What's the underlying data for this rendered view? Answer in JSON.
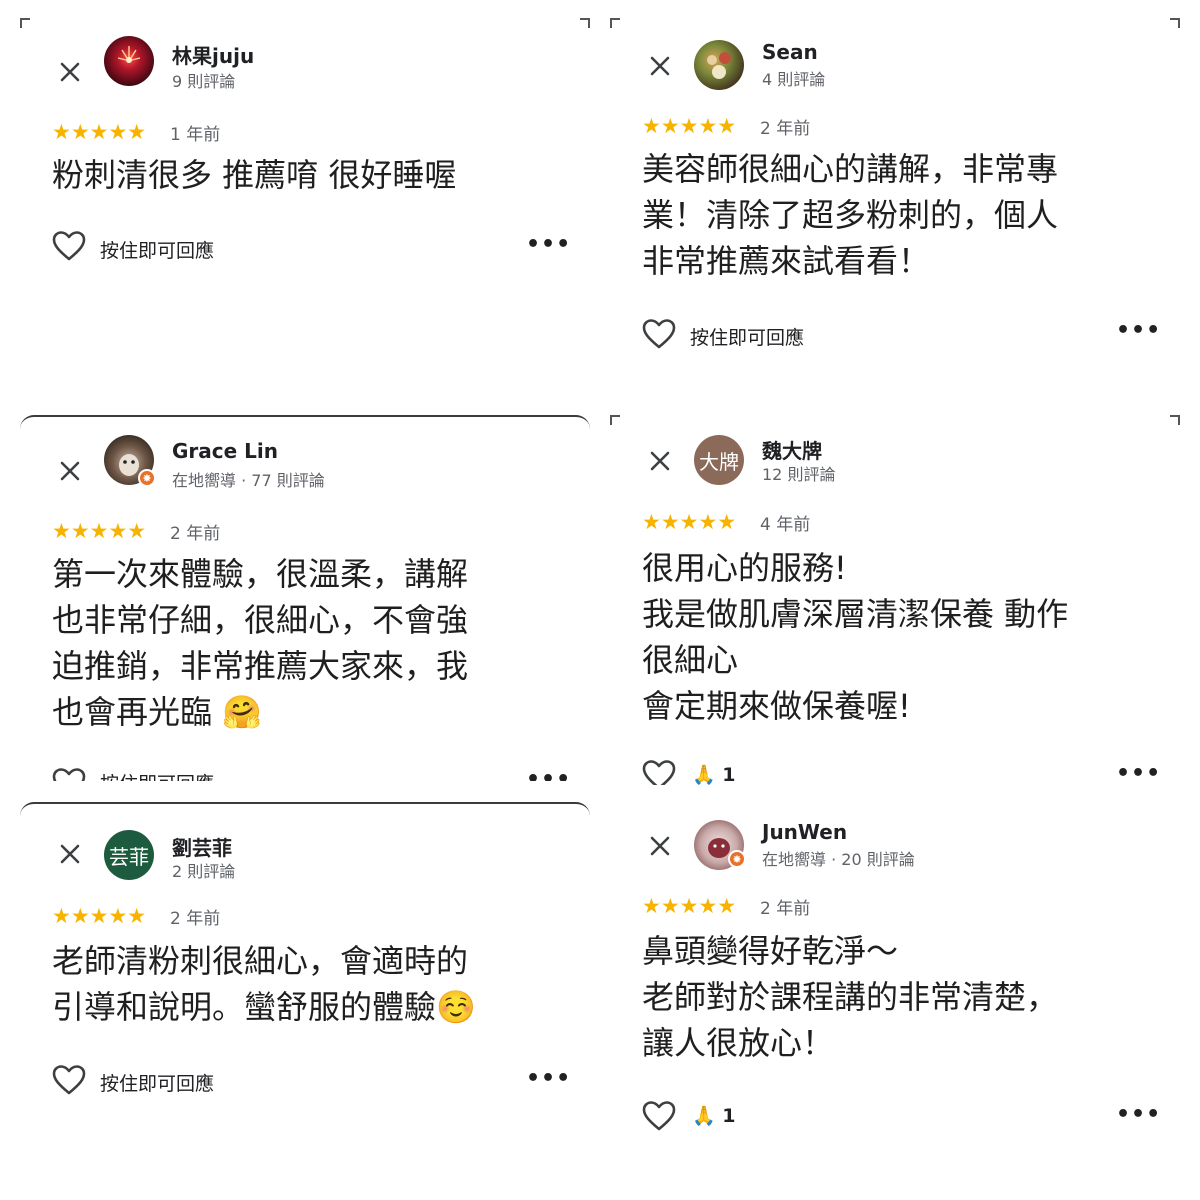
{
  "common": {
    "reply_label": "按住即可回應",
    "more_label": "•••",
    "stars_label": "★★★★★"
  },
  "colors": {
    "star": "#f6b300",
    "local_guide_badge": "#e8712b",
    "avatar_wei": "#8c6a5a",
    "avatar_liu": "#1d5b3f"
  },
  "reviews": [
    {
      "name": "林果juju",
      "meta": "9 則評論",
      "rating": 5,
      "when": "1 年前",
      "text": "粉刺清很多 推薦唷 很好睡喔",
      "reaction": "",
      "avatar_icon": "fireworks-avatar"
    },
    {
      "name": "Sean",
      "meta": "4 則評論",
      "rating": 5,
      "when": "2 年前",
      "text": "美容師很細心的講解，非常專\n業！清除了超多粉刺的，個人\n非常推薦來試看看！",
      "reaction": "",
      "avatar_icon": "food-avatar"
    },
    {
      "name": "Grace Lin",
      "meta": "在地嚮導 · 77 則評論",
      "rating": 5,
      "when": "2 年前",
      "text": "第一次來體驗，很溫柔，講解\n也非常仔細，很細心，不會強\n迫推銷，非常推薦大家來，我\n也會再光臨 🤗",
      "reaction": "",
      "avatar_icon": "dog-avatar"
    },
    {
      "name": "魏大牌",
      "meta": "12 則評論",
      "rating": 5,
      "when": "4 年前",
      "text": "很用心的服務!\n我是做肌膚深層清潔保養 動作\n很細心\n會定期來做保養喔!",
      "reaction": "🙏 1",
      "avatar_text": "大牌"
    },
    {
      "name": "劉芸菲",
      "meta": "2 則評論",
      "rating": 5,
      "when": "2 年前",
      "text": "老師清粉刺很細心，會適時的\n引導和說明。蠻舒服的體驗☺️",
      "reaction": "",
      "avatar_text": "芸菲"
    },
    {
      "name": "JunWen",
      "meta": "在地嚮導 · 20 則評論",
      "rating": 5,
      "when": "2 年前",
      "text": "鼻頭變得好乾淨～\n老師對於課程講的非常清楚，\n讓人很放心！",
      "reaction": "🙏 1",
      "avatar_icon": "plush-avatar"
    }
  ]
}
